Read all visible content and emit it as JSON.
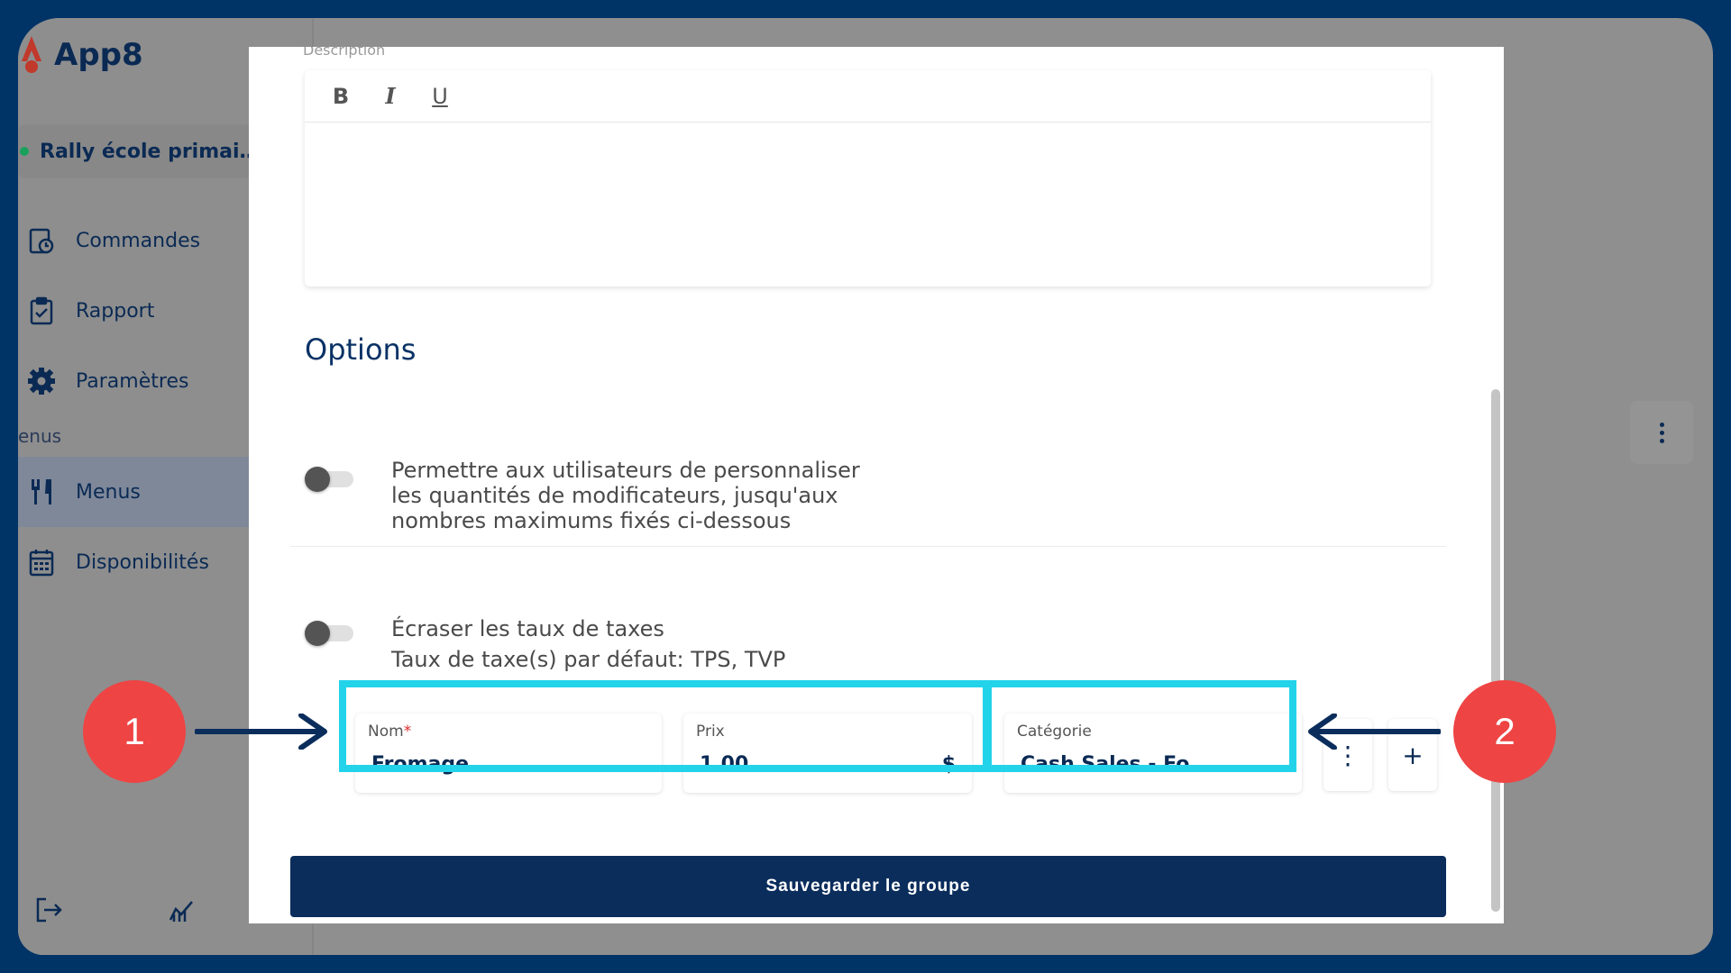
{
  "app": {
    "name": "App8"
  },
  "sidebar": {
    "org_name": "Rally école primai…",
    "items": [
      {
        "label": "Commandes",
        "icon": "orders-clock-icon"
      },
      {
        "label": "Rapport",
        "icon": "clipboard-check-icon"
      },
      {
        "label": "Paramètres",
        "icon": "gear-icon"
      },
      {
        "label": "Menus",
        "icon": "utensils-icon",
        "active": true
      },
      {
        "label": "Disponibilités",
        "icon": "calendar-icon"
      }
    ],
    "section_label": "enus"
  },
  "modal": {
    "description_label": "Description",
    "toolbar": {
      "bold": "B",
      "italic": "I",
      "underline": "U"
    },
    "options_title": "Options",
    "option1_line1": "Permettre aux utilisateurs de personnaliser",
    "option1_line2": "les quantités de modificateurs, jusqu'aux",
    "option1_line3": "nombres maximums fixés ci-dessous",
    "option2_line1": "Écraser les taux de taxes",
    "option2_line2": "Taux de taxe(s) par défaut: TPS, TVP",
    "nom_label": "Nom",
    "nom_required": "*",
    "nom_value": "Fromage",
    "prix_label": "Prix",
    "prix_value": "1.00",
    "prix_suffix": "$",
    "categorie_label": "Catégorie",
    "categorie_value": "Cash Sales - Fo…",
    "add_symbol": "+",
    "save_label": "Sauvegarder le groupe"
  },
  "annotations": {
    "badge1": "1",
    "badge2": "2",
    "highlight_color": "#22d3ea",
    "badge_color": "#ee4444"
  }
}
